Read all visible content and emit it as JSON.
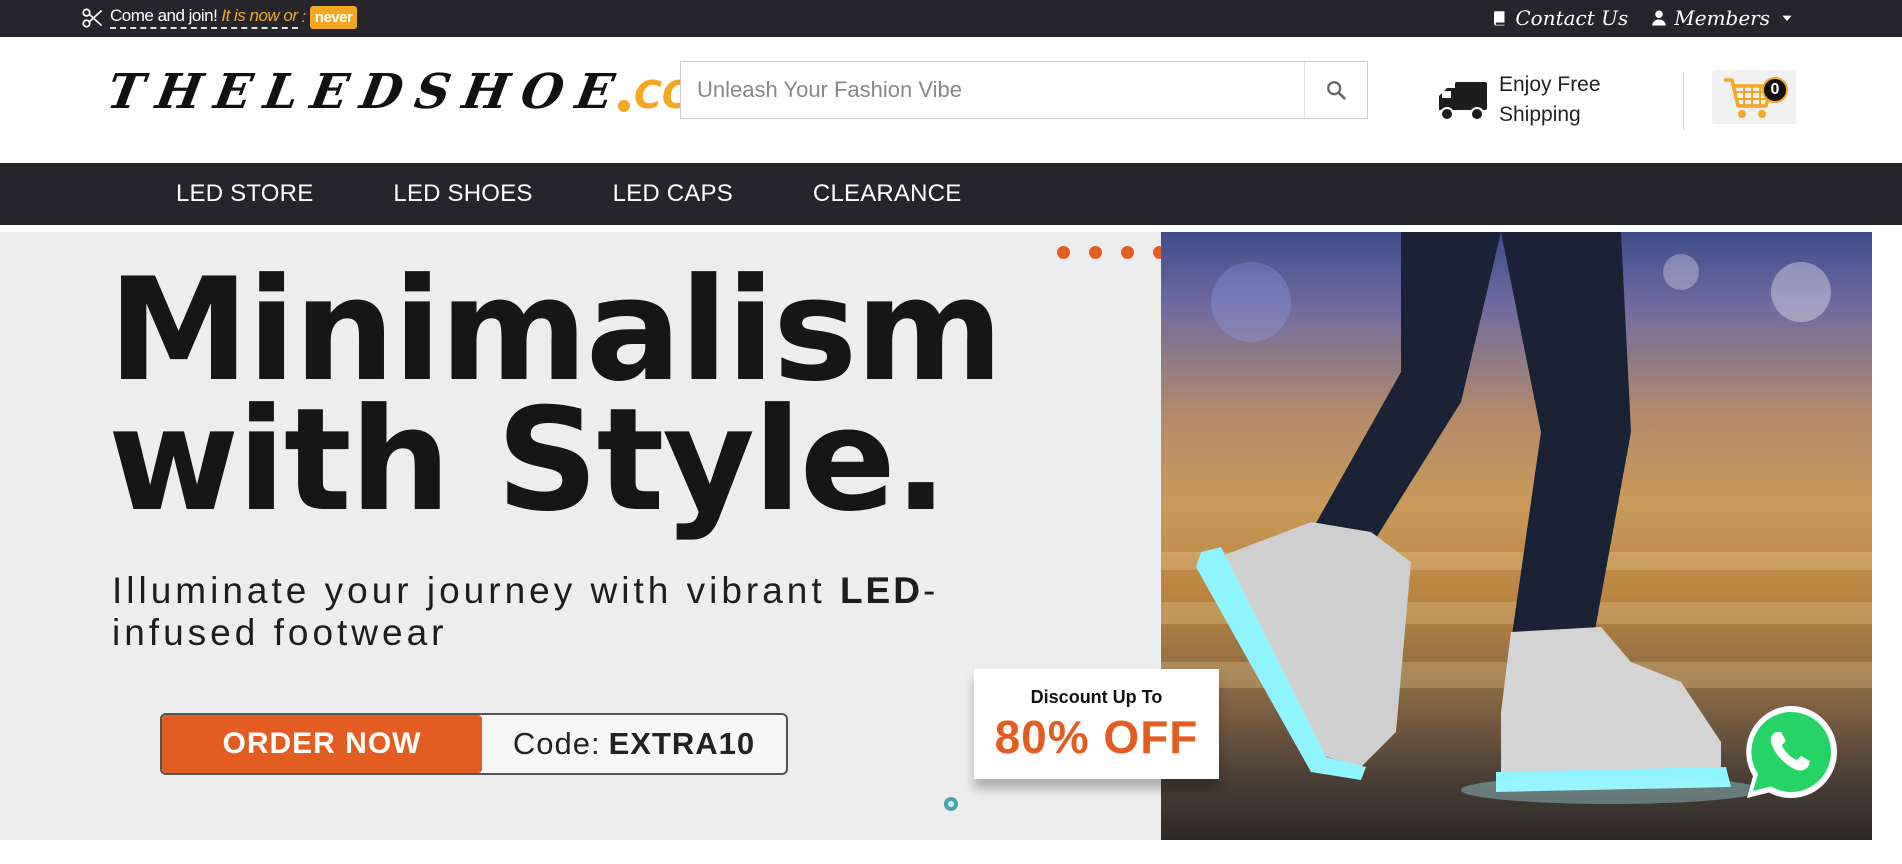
{
  "topbar": {
    "promo_text": "Come and join!",
    "promo_italic": "It is now or",
    "promo_colon": ":",
    "promo_badge": "never",
    "contact": "Contact Us",
    "members": "Members"
  },
  "header": {
    "logo_main": "THELEDSHOE",
    "logo_suffix": "COM",
    "search_placeholder": "Unleash Your Fashion Vibe",
    "shipping_line1": "Enjoy Free",
    "shipping_line2": "Shipping",
    "cart_count": "0"
  },
  "nav": {
    "items": [
      {
        "label": "LED STORE"
      },
      {
        "label": "LED SHOES"
      },
      {
        "label": "LED CAPS"
      },
      {
        "label": "CLEARANCE"
      }
    ]
  },
  "hero": {
    "headline_line1": "Minimalism",
    "headline_line2": "with Style.",
    "subtitle_before": "Illuminate your journey with vibrant ",
    "subtitle_bold": "LED",
    "subtitle_after": "-infused footwear",
    "order_button": "ORDER NOW",
    "code_label": "Code:",
    "code_value": "EXTRA10",
    "discount_label": "Discount Up To",
    "discount_value": "80% OFF",
    "slide_count": 7
  },
  "colors": {
    "dark_bar": "#25252b",
    "accent_orange": "#e35d22",
    "logo_orange": "#f5a623",
    "hero_bg": "#ededed",
    "whatsapp_green": "#25d366"
  },
  "icons": [
    "scissors-icon",
    "book-icon",
    "user-icon",
    "caret-down-icon",
    "search-icon",
    "truck-icon",
    "cart-icon",
    "whatsapp-icon"
  ]
}
